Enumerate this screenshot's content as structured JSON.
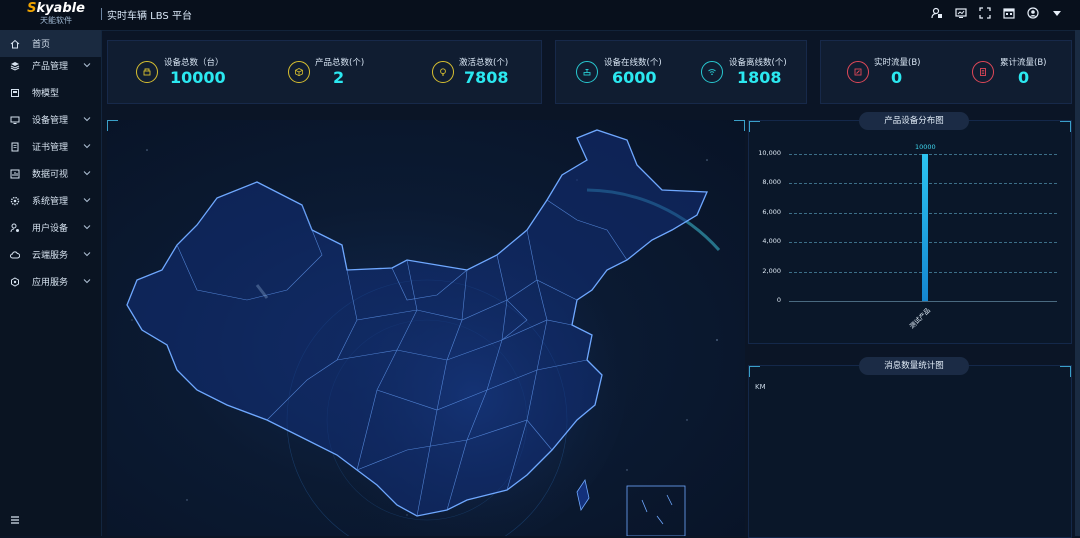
{
  "header": {
    "logo_main": "kyable",
    "logo_initial": "S",
    "logo_sub": "天能软件",
    "app_title": "实时车辆 LBS 平台",
    "icons": [
      "user-config-icon",
      "monitor-icon",
      "fullscreen-icon",
      "calendar-icon",
      "account-icon",
      "dropdown-caret-icon"
    ]
  },
  "sidebar": {
    "items": [
      {
        "label": "首页",
        "icon": "home-icon",
        "active": true
      },
      {
        "label": "产品管理",
        "icon": "layers-icon"
      },
      {
        "label": "物模型",
        "icon": "model-icon"
      },
      {
        "label": "设备管理",
        "icon": "device-icon"
      },
      {
        "label": "证书管理",
        "icon": "certificate-icon"
      },
      {
        "label": "数据可视",
        "icon": "chart-icon"
      },
      {
        "label": "系统管理",
        "icon": "settings-icon"
      },
      {
        "label": "用户设备",
        "icon": "user-device-icon"
      },
      {
        "label": "云端服务",
        "icon": "cloud-icon"
      },
      {
        "label": "应用服务",
        "icon": "apps-icon"
      }
    ],
    "collapse_icon": "menu-icon"
  },
  "stats": {
    "devices_total": {
      "label": "设备总数（台）",
      "value": "10000",
      "color": "#d8c030"
    },
    "products_total": {
      "label": "产品总数(个)",
      "value": "2",
      "color": "#d8c030"
    },
    "activated_total": {
      "label": "激活总数(个)",
      "value": "7808",
      "color": "#d8c030"
    },
    "online": {
      "label": "设备在线数(个)",
      "value": "6000",
      "color": "#28c8d0"
    },
    "offline": {
      "label": "设备离线数(个)",
      "value": "1808",
      "color": "#28c8d0"
    },
    "realtime_traffic": {
      "label": "实时流量(B)",
      "value": "0",
      "color": "#e04858"
    },
    "cumulative_traffic": {
      "label": "累计流量(B)",
      "value": "0",
      "color": "#e04858"
    }
  },
  "charts": {
    "distribution_title": "产品设备分布图",
    "messages_title": "消息数量统计图",
    "messages_unit": "KM"
  },
  "chart_data": {
    "type": "bar",
    "title": "产品设备分布图",
    "categories": [
      "测试产品"
    ],
    "values": [
      10000
    ],
    "ylim": [
      0,
      10000
    ],
    "yticks": [
      "10,000",
      "8,000",
      "6,000",
      "4,000",
      "2,000",
      "0"
    ],
    "data_labels": [
      "10000"
    ]
  }
}
